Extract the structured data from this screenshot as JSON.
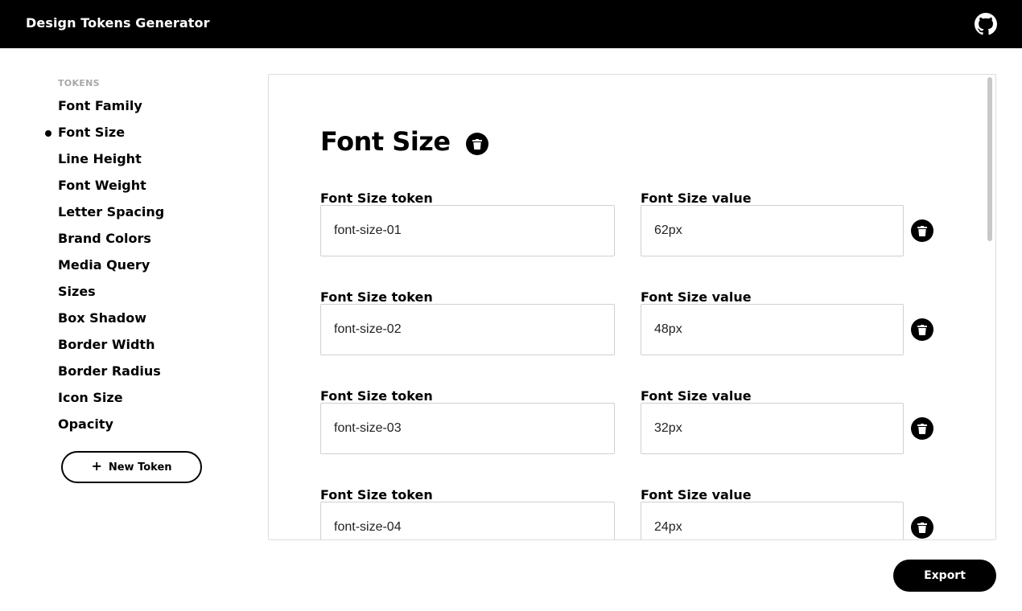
{
  "header": {
    "title": "Design Tokens Generator",
    "github_icon": "github-icon"
  },
  "sidebar": {
    "heading": "TOKENS",
    "active_item": "Font Size",
    "items": [
      {
        "label": "Font Family"
      },
      {
        "label": "Font Size"
      },
      {
        "label": "Line Height"
      },
      {
        "label": "Font Weight"
      },
      {
        "label": "Letter Spacing"
      },
      {
        "label": "Brand Colors"
      },
      {
        "label": "Media Query"
      },
      {
        "label": "Sizes"
      },
      {
        "label": "Box Shadow"
      },
      {
        "label": "Border Width"
      },
      {
        "label": "Border Radius"
      },
      {
        "label": "Icon Size"
      },
      {
        "label": "Opacity"
      }
    ],
    "new_token_label": "New Token",
    "new_token_icon": "plus-icon"
  },
  "main": {
    "title": "Font Size",
    "rows": [
      {
        "token_label": "Font Size token",
        "token": "font-size-01",
        "value_label": "Font Size value",
        "value": "62px"
      },
      {
        "token_label": "Font Size token",
        "token": "font-size-02",
        "value_label": "Font Size value",
        "value": "48px"
      },
      {
        "token_label": "Font Size token",
        "token": "font-size-03",
        "value_label": "Font Size value",
        "value": "32px"
      },
      {
        "token_label": "Font Size token",
        "token": "font-size-04",
        "value_label": "Font Size value",
        "value": "24px"
      }
    ]
  },
  "footer": {
    "export_label": "Export"
  },
  "colors": {
    "header_bg": "#000000",
    "accent": "#000000",
    "muted_heading": "#a9a9a9",
    "input_border": "#d0d0d0"
  }
}
